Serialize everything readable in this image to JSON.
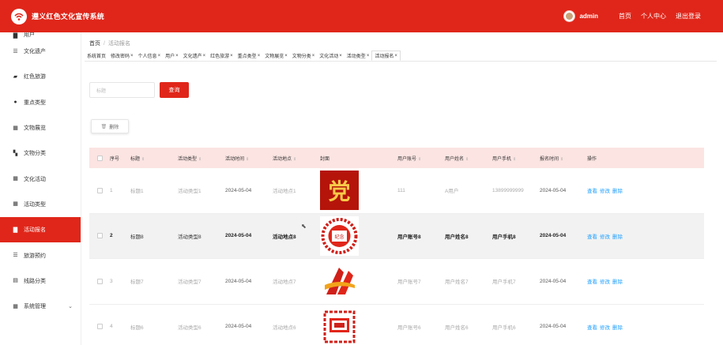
{
  "app": {
    "title": "遵义红色文化宣传系统"
  },
  "top_nav": {
    "user_name": "admin",
    "links": [
      "首页",
      "个人中心",
      "退出登录"
    ]
  },
  "sidebar": {
    "items": [
      {
        "label": "用户",
        "icon": "document-icon"
      },
      {
        "label": "文化遗产",
        "icon": "list-icon"
      },
      {
        "label": "红色旅游",
        "icon": "camera-icon"
      },
      {
        "label": "重点类型",
        "icon": "user-icon"
      },
      {
        "label": "文物展览",
        "icon": "grid-icon"
      },
      {
        "label": "文物分类",
        "icon": "ticket-icon"
      },
      {
        "label": "文化活动",
        "icon": "grid-icon"
      },
      {
        "label": "活动类型",
        "icon": "grid-icon"
      },
      {
        "label": "活动报名",
        "icon": "document-icon",
        "active": true
      },
      {
        "label": "旅游预约",
        "icon": "list-icon"
      },
      {
        "label": "线路分类",
        "icon": "database-icon"
      },
      {
        "label": "系统管理",
        "icon": "grid-icon",
        "expandable": true
      }
    ]
  },
  "breadcrumb": {
    "home": "首页",
    "current": "活动报名"
  },
  "tabs": [
    {
      "label": "系统首页",
      "closable": false
    },
    {
      "label": "修改密码",
      "closable": true
    },
    {
      "label": "个人信息",
      "closable": true
    },
    {
      "label": "用户",
      "closable": true
    },
    {
      "label": "文化遗产",
      "closable": true
    },
    {
      "label": "红色旅游",
      "closable": true
    },
    {
      "label": "重点类型",
      "closable": true
    },
    {
      "label": "文物展览",
      "closable": true
    },
    {
      "label": "文物分类",
      "closable": true
    },
    {
      "label": "文化活动",
      "closable": true
    },
    {
      "label": "活动类型",
      "closable": true
    },
    {
      "label": "活动报名",
      "closable": true,
      "active": true
    }
  ],
  "search": {
    "placeholder": "标题",
    "button": "查询"
  },
  "toolbar": {
    "delete_label": "删除"
  },
  "table": {
    "columns": [
      "序号",
      "标题",
      "活动类型",
      "活动时间",
      "活动地点",
      "封面",
      "用户账号",
      "用户姓名",
      "用户手机",
      "报名时间",
      "操作"
    ],
    "actions": [
      "查看",
      "修改",
      "删除"
    ],
    "rows": [
      {
        "no": "1",
        "title": "标题1",
        "type": "活动类型1",
        "time": "2024-05-04",
        "place": "活动地点1",
        "cover": "party-calligraphy",
        "account": "111",
        "name": "A用户",
        "phone": "13899999999",
        "reg_time": "2024-05-04"
      },
      {
        "no": "2",
        "title": "标题8",
        "type": "活动类型8",
        "time": "2024-05-04",
        "place": "活动地点8",
        "cover": "papercut-seal",
        "account": "用户账号8",
        "name": "用户姓名8",
        "phone": "用户手机8",
        "reg_time": "2024-05-04",
        "highlight": true
      },
      {
        "no": "3",
        "title": "标题7",
        "type": "活动类型7",
        "time": "2024-05-04",
        "place": "活动地点7",
        "cover": "red-emblem",
        "account": "用户账号7",
        "name": "用户姓名7",
        "phone": "用户手机7",
        "reg_time": "2024-05-04"
      },
      {
        "no": "4",
        "title": "标题6",
        "type": "活动类型6",
        "time": "2024-05-04",
        "place": "活动地点6",
        "cover": "papercut-china",
        "account": "用户账号6",
        "name": "用户姓名6",
        "phone": "用户手机6",
        "reg_time": "2024-05-04"
      }
    ]
  },
  "colors": {
    "primary": "#e0261a",
    "header_row": "#fbe4e2",
    "link": "#1e9fff"
  }
}
